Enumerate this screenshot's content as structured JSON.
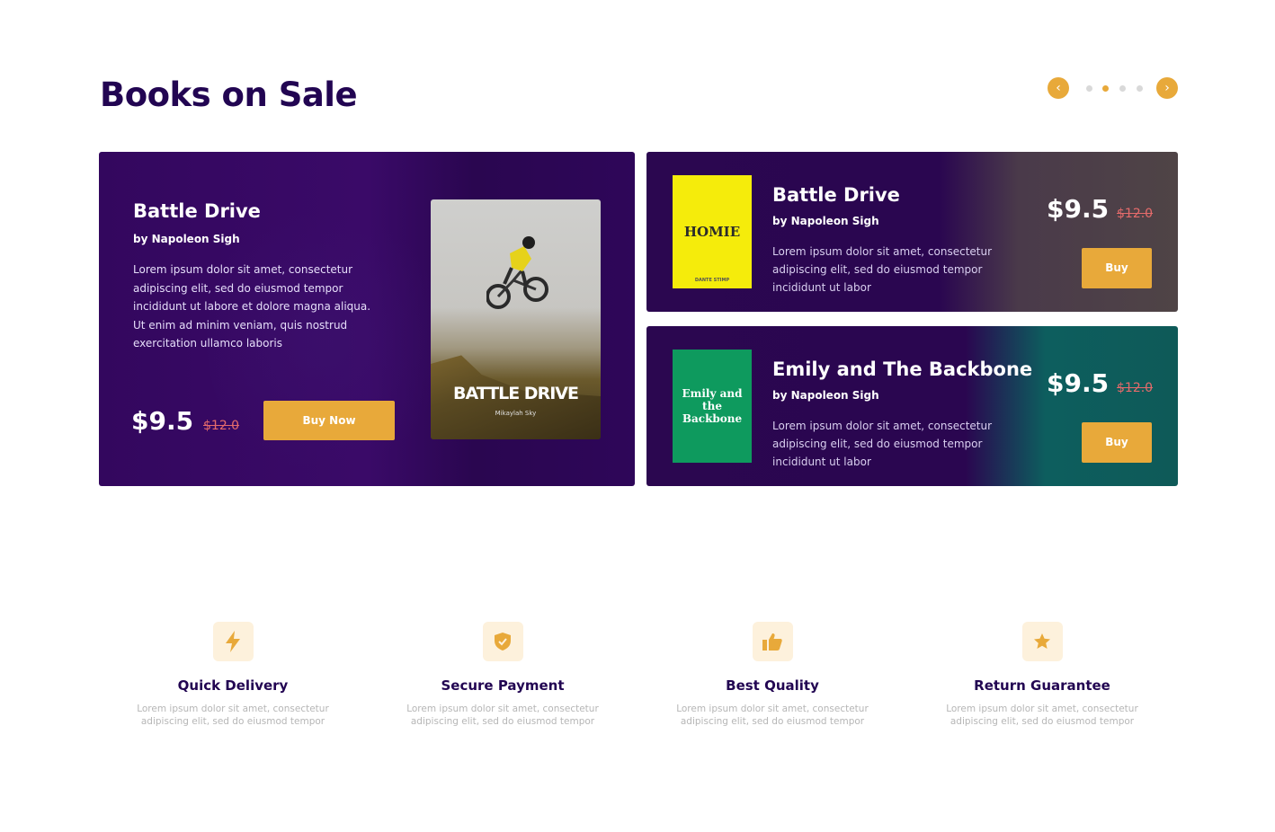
{
  "section": {
    "title": "Books on Sale"
  },
  "slider": {
    "prev_icon": "chevron-left-icon",
    "next_icon": "chevron-right-icon",
    "prev_glyph": "‹",
    "next_glyph": "›",
    "dot_count": 4,
    "active_dot": 2,
    "accent": "#e8a93a"
  },
  "hero": {
    "title": "Battle Drive",
    "author": "by Napoleon Sigh",
    "description": "Lorem ipsum dolor sit amet, consectetur adipiscing elit, sed do eiusmod tempor incididunt ut labore et dolore magna aliqua. Ut enim ad minim veniam, quis nostrud exercitation ullamco laboris",
    "price": "$9.5",
    "old_price": "$12.0",
    "buy_label": "Buy Now",
    "cover": {
      "title": "BATTLE DRIVE",
      "subtitle": "Mikaylah Sky"
    }
  },
  "side_books": [
    {
      "title": "Battle Drive",
      "author": "by Napoleon Sigh",
      "description": "Lorem ipsum dolor sit amet, consectetur adipiscing elit, sed do eiusmod tempor incididunt ut labor",
      "price": "$9.5",
      "old_price": "$12.0",
      "buy_label": "Buy",
      "cover": {
        "title": "HOMIE",
        "subtitle": "DANTE STIMP",
        "color": "#f5ec0b"
      }
    },
    {
      "title": "Emily and The Backbone",
      "author": "by Napoleon Sigh",
      "description": "Lorem ipsum dolor sit amet, consectetur adipiscing elit, sed do eiusmod tempor incididunt ut labor",
      "price": "$9.5",
      "old_price": "$12.0",
      "buy_label": "Buy",
      "cover": {
        "title": "Emily and the Backbone",
        "color": "#0e9a5e"
      }
    }
  ],
  "features": [
    {
      "icon": "lightning-icon",
      "title": "Quick Delivery",
      "desc_1": "Lorem ipsum dolor sit amet, consectetur",
      "desc_2": "adipiscing elit, sed do eiusmod tempor"
    },
    {
      "icon": "shield-icon",
      "title": "Secure Payment",
      "desc_1": "Lorem ipsum dolor sit amet, consectetur",
      "desc_2": "adipiscing elit, sed do eiusmod tempor"
    },
    {
      "icon": "thumbs-up-icon",
      "title": "Best Quality",
      "desc_1": "Lorem ipsum dolor sit amet, consectetur",
      "desc_2": "adipiscing elit, sed do eiusmod tempor"
    },
    {
      "icon": "star-icon",
      "title": "Return Guarantee",
      "desc_1": "Lorem ipsum dolor sit amet, consectetur",
      "desc_2": "adipiscing elit, sed do eiusmod tempor"
    }
  ]
}
